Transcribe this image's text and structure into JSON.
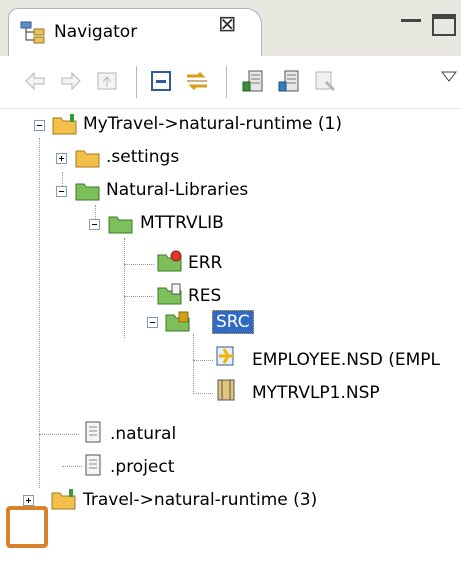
{
  "view": {
    "tab_title": "Navigator",
    "tab_close_symbol": "⊠"
  },
  "toolbar": {
    "icons": [
      "back-arrow-icon",
      "forward-arrow-icon",
      "go-into-icon",
      "collapse-all-icon",
      "link-with-editor-icon",
      "natural-object-icon",
      "natural-library-icon",
      "filter-icon",
      "view-menu-icon"
    ]
  },
  "tree": {
    "project1": "MyTravel->natural-runtime (1)",
    "settings": ".settings",
    "natural_libraries": "Natural-Libraries",
    "mttrvlib": "MTTRVLIB",
    "err": "ERR",
    "res": "RES",
    "src": "SRC",
    "employee": "EMPLOYEE.NSD (EMPL",
    "mytrvlp1": "MYTRVLP1.NSP",
    "natural_file": ".natural",
    "project_file": ".project",
    "project2": "Travel->natural-runtime (3)"
  },
  "colors": {
    "selection": "#316ac5",
    "highlight": "#d9822b",
    "folder": "#f2c04a"
  }
}
